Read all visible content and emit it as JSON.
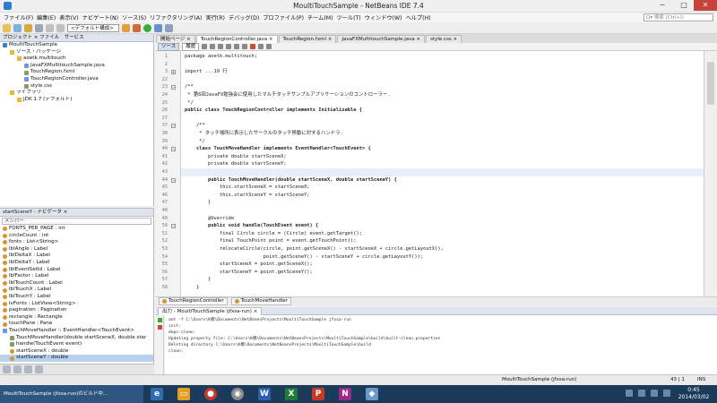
{
  "window": {
    "title": "MoultiTouchSample - NetBeans IDE 7.4",
    "minimize": "─",
    "maximize": "□",
    "close": "✕"
  },
  "menu": [
    "ファイル(F)",
    "編集(E)",
    "表示(V)",
    "ナビゲート(N)",
    "ソース(S)",
    "リファクタリング(A)",
    "実行(R)",
    "デバッグ(D)",
    "プロファイル(P)",
    "チーム(M)",
    "ツール(T)",
    "ウィンドウ(W)",
    "ヘルプ(H)"
  ],
  "search": {
    "placeholder": "Q▾ 検索 (Ctrl+I)"
  },
  "toolbar": {
    "config": "<デフォルト構成>"
  },
  "project_pane": {
    "title": "プロジェクト × ファイル　サービス",
    "tree": [
      {
        "label": "MoultiTouchSample",
        "level": 0,
        "icon": "p"
      },
      {
        "label": "ソース・パッケージ",
        "level": 1,
        "icon": "f"
      },
      {
        "label": "aoetk.multitouch",
        "level": 2,
        "icon": "f"
      },
      {
        "label": "JavaFXMultitouchSample.java",
        "level": 3,
        "icon": "j"
      },
      {
        "label": "TouchRegion.fxml",
        "level": 3,
        "icon": "m"
      },
      {
        "label": "TouchRegionController.java",
        "level": 3,
        "icon": "j"
      },
      {
        "label": "style.css",
        "level": 3,
        "icon": "m"
      },
      {
        "label": "ライブラリ",
        "level": 1,
        "icon": "f"
      },
      {
        "label": "JDK 1.7 (デフォルト)",
        "level": 2,
        "icon": "f"
      }
    ]
  },
  "navigator": {
    "title": "startSceneY - ナビゲータ ×",
    "filter": "メンバー",
    "items": [
      {
        "label": "FONTS_PER_PAGE : int",
        "level": 0,
        "icon": "c"
      },
      {
        "label": "circleCount : int",
        "level": 0,
        "icon": "c"
      },
      {
        "label": "fonts : List<String>",
        "level": 0,
        "icon": "c"
      },
      {
        "label": "lblAngle : Label",
        "level": 0,
        "icon": "c"
      },
      {
        "label": "lblDeltaX : Label",
        "level": 0,
        "icon": "c"
      },
      {
        "label": "lblDeltaY : Label",
        "level": 0,
        "icon": "c"
      },
      {
        "label": "lblEventSetId : Label",
        "level": 0,
        "icon": "c"
      },
      {
        "label": "lblFactor : Label",
        "level": 0,
        "icon": "c"
      },
      {
        "label": "lblTouchCount : Label",
        "level": 0,
        "icon": "c"
      },
      {
        "label": "lblTouchX : Label",
        "level": 0,
        "icon": "c"
      },
      {
        "label": "lblTouchY : Label",
        "level": 0,
        "icon": "c"
      },
      {
        "label": "lvFonts : ListView<String>",
        "level": 0,
        "icon": "c"
      },
      {
        "label": "pagination : Pagination",
        "level": 0,
        "icon": "c"
      },
      {
        "label": "rectangle : Rectangle",
        "level": 0,
        "icon": "c"
      },
      {
        "label": "touchPane : Pane",
        "level": 0,
        "icon": "c"
      },
      {
        "label": "TouchMoveHandler :: EventHandler<TouchEvent>",
        "level": 0,
        "icon": "j"
      },
      {
        "label": "TouchMoveHandler(double startSceneX, double star",
        "level": 1,
        "icon": "m"
      },
      {
        "label": "handle(TouchEvent event)",
        "level": 1,
        "icon": "m"
      },
      {
        "label": "startSceneX : double",
        "level": 1,
        "icon": "c"
      },
      {
        "label": "startSceneY : double",
        "level": 1,
        "icon": "c",
        "selected": true
      }
    ]
  },
  "editor": {
    "tabs": [
      {
        "label": "開始ページ ×",
        "active": false
      },
      {
        "label": "TouchRegionController.java ×",
        "active": true
      },
      {
        "label": "TouchRegion.fxml ×",
        "active": false
      },
      {
        "label": "JavaFXMultitouchSample.java ×",
        "active": false
      },
      {
        "label": "style.css ×",
        "active": false
      }
    ],
    "modes": [
      "ソース",
      "履歴"
    ],
    "lines": [
      {
        "n": "1",
        "t": "package aoetk.multitouch;",
        "k": "plain"
      },
      {
        "n": "2",
        "t": "",
        "k": "plain"
      },
      {
        "n": "3",
        "t": "import ...19 行",
        "k": "kw",
        "fold": "+"
      },
      {
        "n": "22",
        "t": "",
        "k": "plain"
      },
      {
        "n": "23",
        "t": "/**",
        "k": "cm",
        "fold": "-"
      },
      {
        "n": "24",
        "t": " * 第6回JavaFX勉強会に使用したマルチタッチサンプルアプリケーションのコントローラー.",
        "k": "cm"
      },
      {
        "n": "25",
        "t": " */",
        "k": "cm"
      },
      {
        "n": "26",
        "t": "public class TouchRegionController implements Initializable {",
        "k": "decl"
      },
      {
        "n": "27",
        "t": "",
        "k": "plain"
      },
      {
        "n": "37",
        "t": "    /**",
        "k": "cm",
        "fold": "-"
      },
      {
        "n": "38",
        "t": "     * タッチ場所に表示したサークルのタッチ移動に対するハンドラ.",
        "k": "cm"
      },
      {
        "n": "39",
        "t": "     */",
        "k": "cm"
      },
      {
        "n": "40",
        "t": "    class TouchMoveHandler implements EventHandler<TouchEvent> {",
        "k": "decl",
        "fold": "-"
      },
      {
        "n": "41",
        "t": "        private double startSceneX;",
        "k": "field"
      },
      {
        "n": "42",
        "t": "        private double startSceneY;",
        "k": "field"
      },
      {
        "n": "43",
        "t": "",
        "k": "plain",
        "cur": true
      },
      {
        "n": "44",
        "t": "        public TouchMoveHandler(double startSceneX, double startSceneY) {",
        "k": "decl",
        "fold": "-"
      },
      {
        "n": "45",
        "t": "            this.startSceneX = startSceneX;",
        "k": "field"
      },
      {
        "n": "46",
        "t": "            this.startSceneY = startSceneY;",
        "k": "field"
      },
      {
        "n": "47",
        "t": "        }",
        "k": "plain"
      },
      {
        "n": "48",
        "t": "",
        "k": "plain"
      },
      {
        "n": "49",
        "t": "        @Override",
        "k": "plain"
      },
      {
        "n": "50",
        "t": "        public void handle(TouchEvent event) {",
        "k": "decl",
        "fold": "-"
      },
      {
        "n": "51",
        "t": "            final Circle circle = (Circle) event.getTarget();",
        "k": "kw"
      },
      {
        "n": "52",
        "t": "            final TouchPoint point = event.getTouchPoint();",
        "k": "kw"
      },
      {
        "n": "53",
        "t": "            relocateCircle(circle, point.getSceneX() - startSceneX + circle.getLayoutX(),",
        "k": "plain"
      },
      {
        "n": "54",
        "t": "                           point.getSceneY() - startSceneY + circle.getLayoutY());",
        "k": "plain"
      },
      {
        "n": "55",
        "t": "            startSceneX = point.getSceneX();",
        "k": "field"
      },
      {
        "n": "56",
        "t": "            startSceneY = point.getSceneY();",
        "k": "field"
      },
      {
        "n": "57",
        "t": "        }",
        "k": "plain"
      },
      {
        "n": "58",
        "t": "    }",
        "k": "plain"
      }
    ],
    "breadcrumbs": [
      "TouchRegionController",
      "TouchMoveHandler"
    ]
  },
  "output": {
    "title": "出力 - MoultiTouchSample (jfxsa-run) ×",
    "lines": [
      "ant -f C:\\Users\\K橋\\Documents\\NetBeansProjects\\MoultiTouchSample jfxsa-run",
      "init:",
      "deps-clean:",
      "Updating property file: C:\\Users\\K橋\\Documents\\NetBeansProjects\\MoultiTouchSample\\build\\built-clean.properties",
      "Deleting directory C:\\Users\\K橋\\Documents\\NetBeansProjects\\MoultiTouchSample\\build",
      "clean:"
    ]
  },
  "status": {
    "task": "MoultiTouchSample (jfxsa-run)",
    "position": "43 | 1",
    "mode": "INS",
    "bottom_left": "MoultiTouchSample (jfxsa-run)のビルド中..."
  },
  "taskbar": {
    "time": "0:45",
    "date": "2014/03/02"
  }
}
